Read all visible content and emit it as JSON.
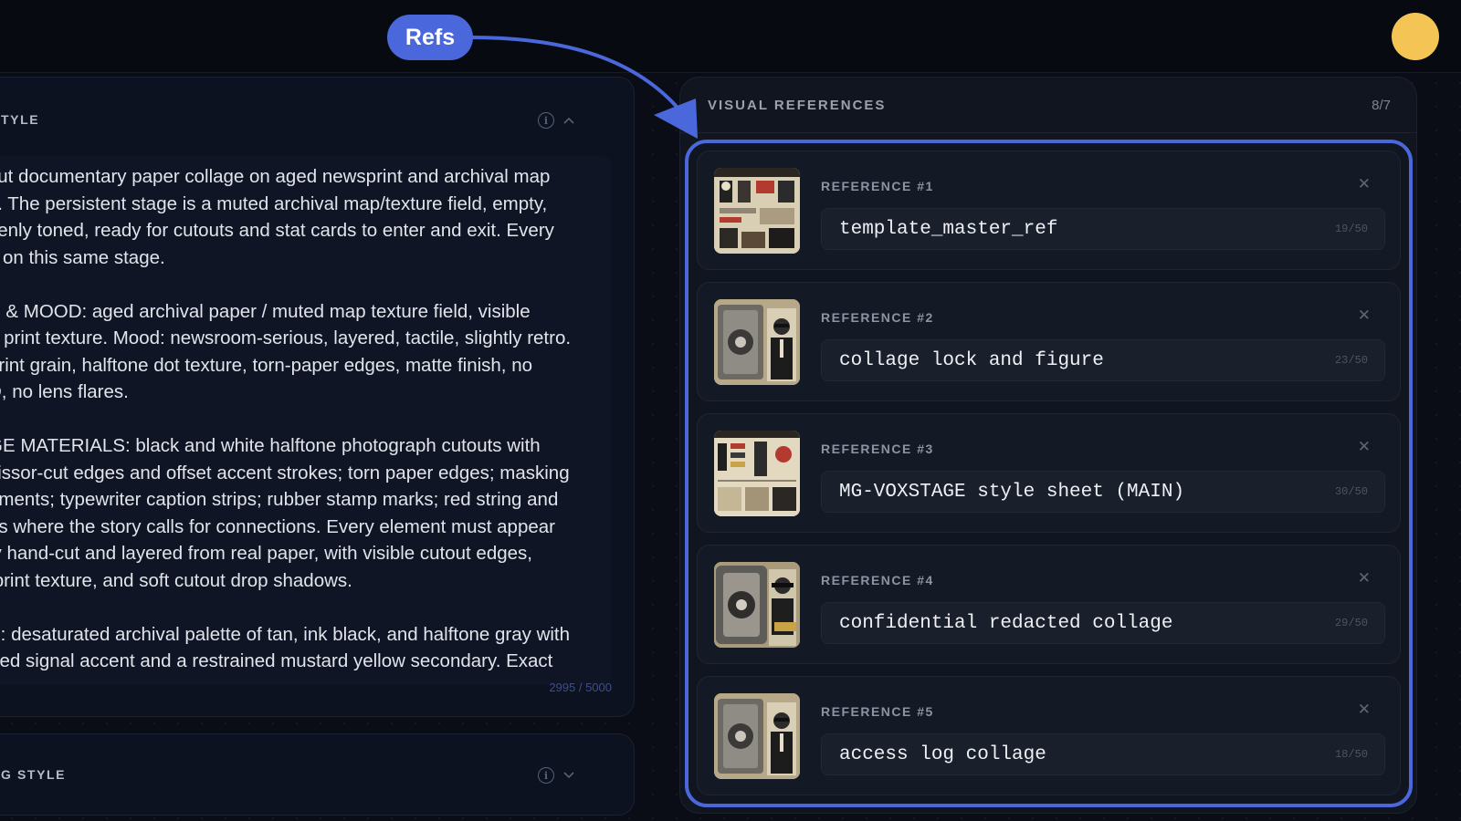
{
  "annotation": {
    "bubble_label": "Refs",
    "accent": "#4a68dc"
  },
  "style_panel": {
    "title": "TYLE",
    "prompt_text": "cut documentary paper collage on aged newsprint and archival map\ns. The persistent stage is a muted archival map/texture field, empty,\nvenly toned, ready for cutouts and stat cards to enter and exit. Every\ns on this same stage.\n\nE & MOOD: aged archival paper / muted map texture field, visible\nd print texture. Mood: newsroom-serious, layered, tactile, slightly retro.\nprint grain, halftone dot texture, torn-paper edges, matte finish, no\nD, no lens flares.\n\nGE MATERIALS: black and white halftone photograph cutouts with\ncissor-cut edges and offset accent strokes; torn paper edges; masking\ngments; typewriter caption strips; rubber stamp marks; red string and\nns where the story calls for connections. Every element must appear\nly hand-cut and layered from real paper, with visible cutout edges,\n print texture, and soft cutout drop shadows.\n\nE: desaturated archival palette of tan, ink black, and halftone gray with\n red signal accent and a restrained mustard yellow secondary. Exact",
    "char_count": "2995 / 5000"
  },
  "style_panel_2": {
    "title": "G STYLE"
  },
  "references": {
    "title": "VISUAL REFERENCES",
    "count": "8/7",
    "items": [
      {
        "label": "REFERENCE #1",
        "name": "template_master_ref",
        "char_count": "19/50",
        "thumb": "sheet"
      },
      {
        "label": "REFERENCE #2",
        "name": "collage lock and figure",
        "char_count": "23/50",
        "thumb": "lock"
      },
      {
        "label": "REFERENCE #3",
        "name": "MG-VOXSTAGE style sheet (MAIN)",
        "char_count": "30/50",
        "thumb": "sheet2"
      },
      {
        "label": "REFERENCE #4",
        "name": "confidential redacted collage",
        "char_count": "29/50",
        "thumb": "lock2"
      },
      {
        "label": "REFERENCE #5",
        "name": "access log collage",
        "char_count": "18/50",
        "thumb": "lock"
      }
    ]
  },
  "colors": {
    "avatar": "#f4c554",
    "background": "#0a0d16"
  }
}
